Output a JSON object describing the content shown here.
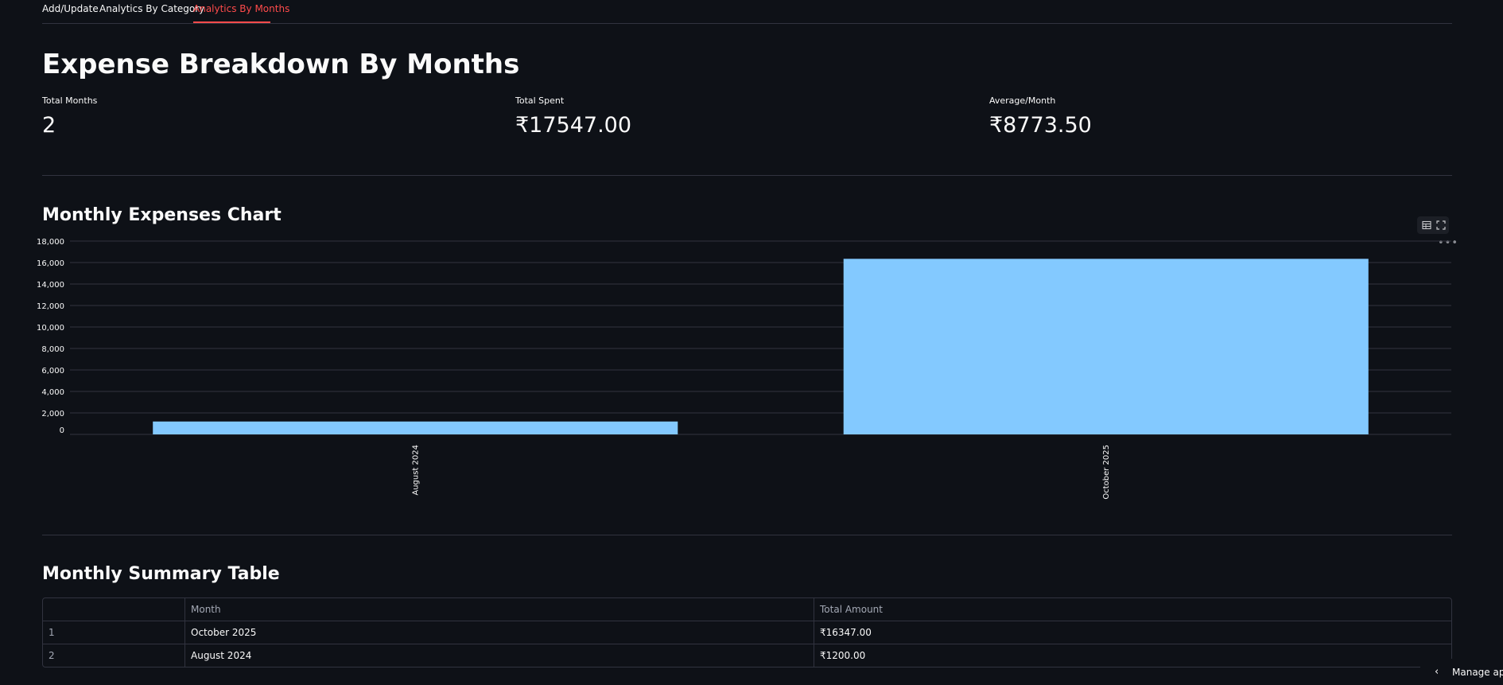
{
  "tabs": [
    {
      "label": "Add/Update",
      "active": false
    },
    {
      "label": "Analytics By Category",
      "active": false
    },
    {
      "label": "Analytics By Months",
      "active": true
    }
  ],
  "page_title": "Expense Breakdown By Months",
  "metrics": [
    {
      "label": "Total Months",
      "value": "2"
    },
    {
      "label": "Total Spent",
      "value": "₹17547.00"
    },
    {
      "label": "Average/Month",
      "value": "₹8773.50"
    }
  ],
  "chart_section": {
    "title": "Monthly Expenses Chart",
    "toolbar_icons": [
      "table-view-icon",
      "fullscreen-icon",
      "more-options-icon"
    ]
  },
  "chart_data": {
    "type": "bar",
    "categories": [
      "August 2024",
      "October 2025"
    ],
    "values": [
      1200,
      16347
    ],
    "ylim": [
      0,
      18000
    ],
    "yticks": [
      0,
      2000,
      4000,
      6000,
      8000,
      10000,
      12000,
      14000,
      16000,
      18000
    ],
    "ytick_labels": [
      "0",
      "2,000",
      "4,000",
      "6,000",
      "8,000",
      "10,000",
      "12,000",
      "14,000",
      "16,000",
      "18,000"
    ],
    "xlabel": "",
    "ylabel": "",
    "bar_color": "#83c9ff",
    "grid": true
  },
  "table_section": {
    "title": "Monthly Summary Table",
    "columns": [
      "",
      "Month",
      "Total Amount"
    ],
    "rows": [
      {
        "index": "1",
        "month": "October 2025",
        "amount": "₹16347.00"
      },
      {
        "index": "2",
        "month": "August 2024",
        "amount": "₹1200.00"
      }
    ]
  },
  "manage_app": {
    "label": "Manage app",
    "icon": "chevron-left-icon"
  },
  "colors": {
    "background": "#0e1117",
    "accent": "#ff4b4b",
    "bar": "#83c9ff",
    "grid": "#31333f"
  }
}
